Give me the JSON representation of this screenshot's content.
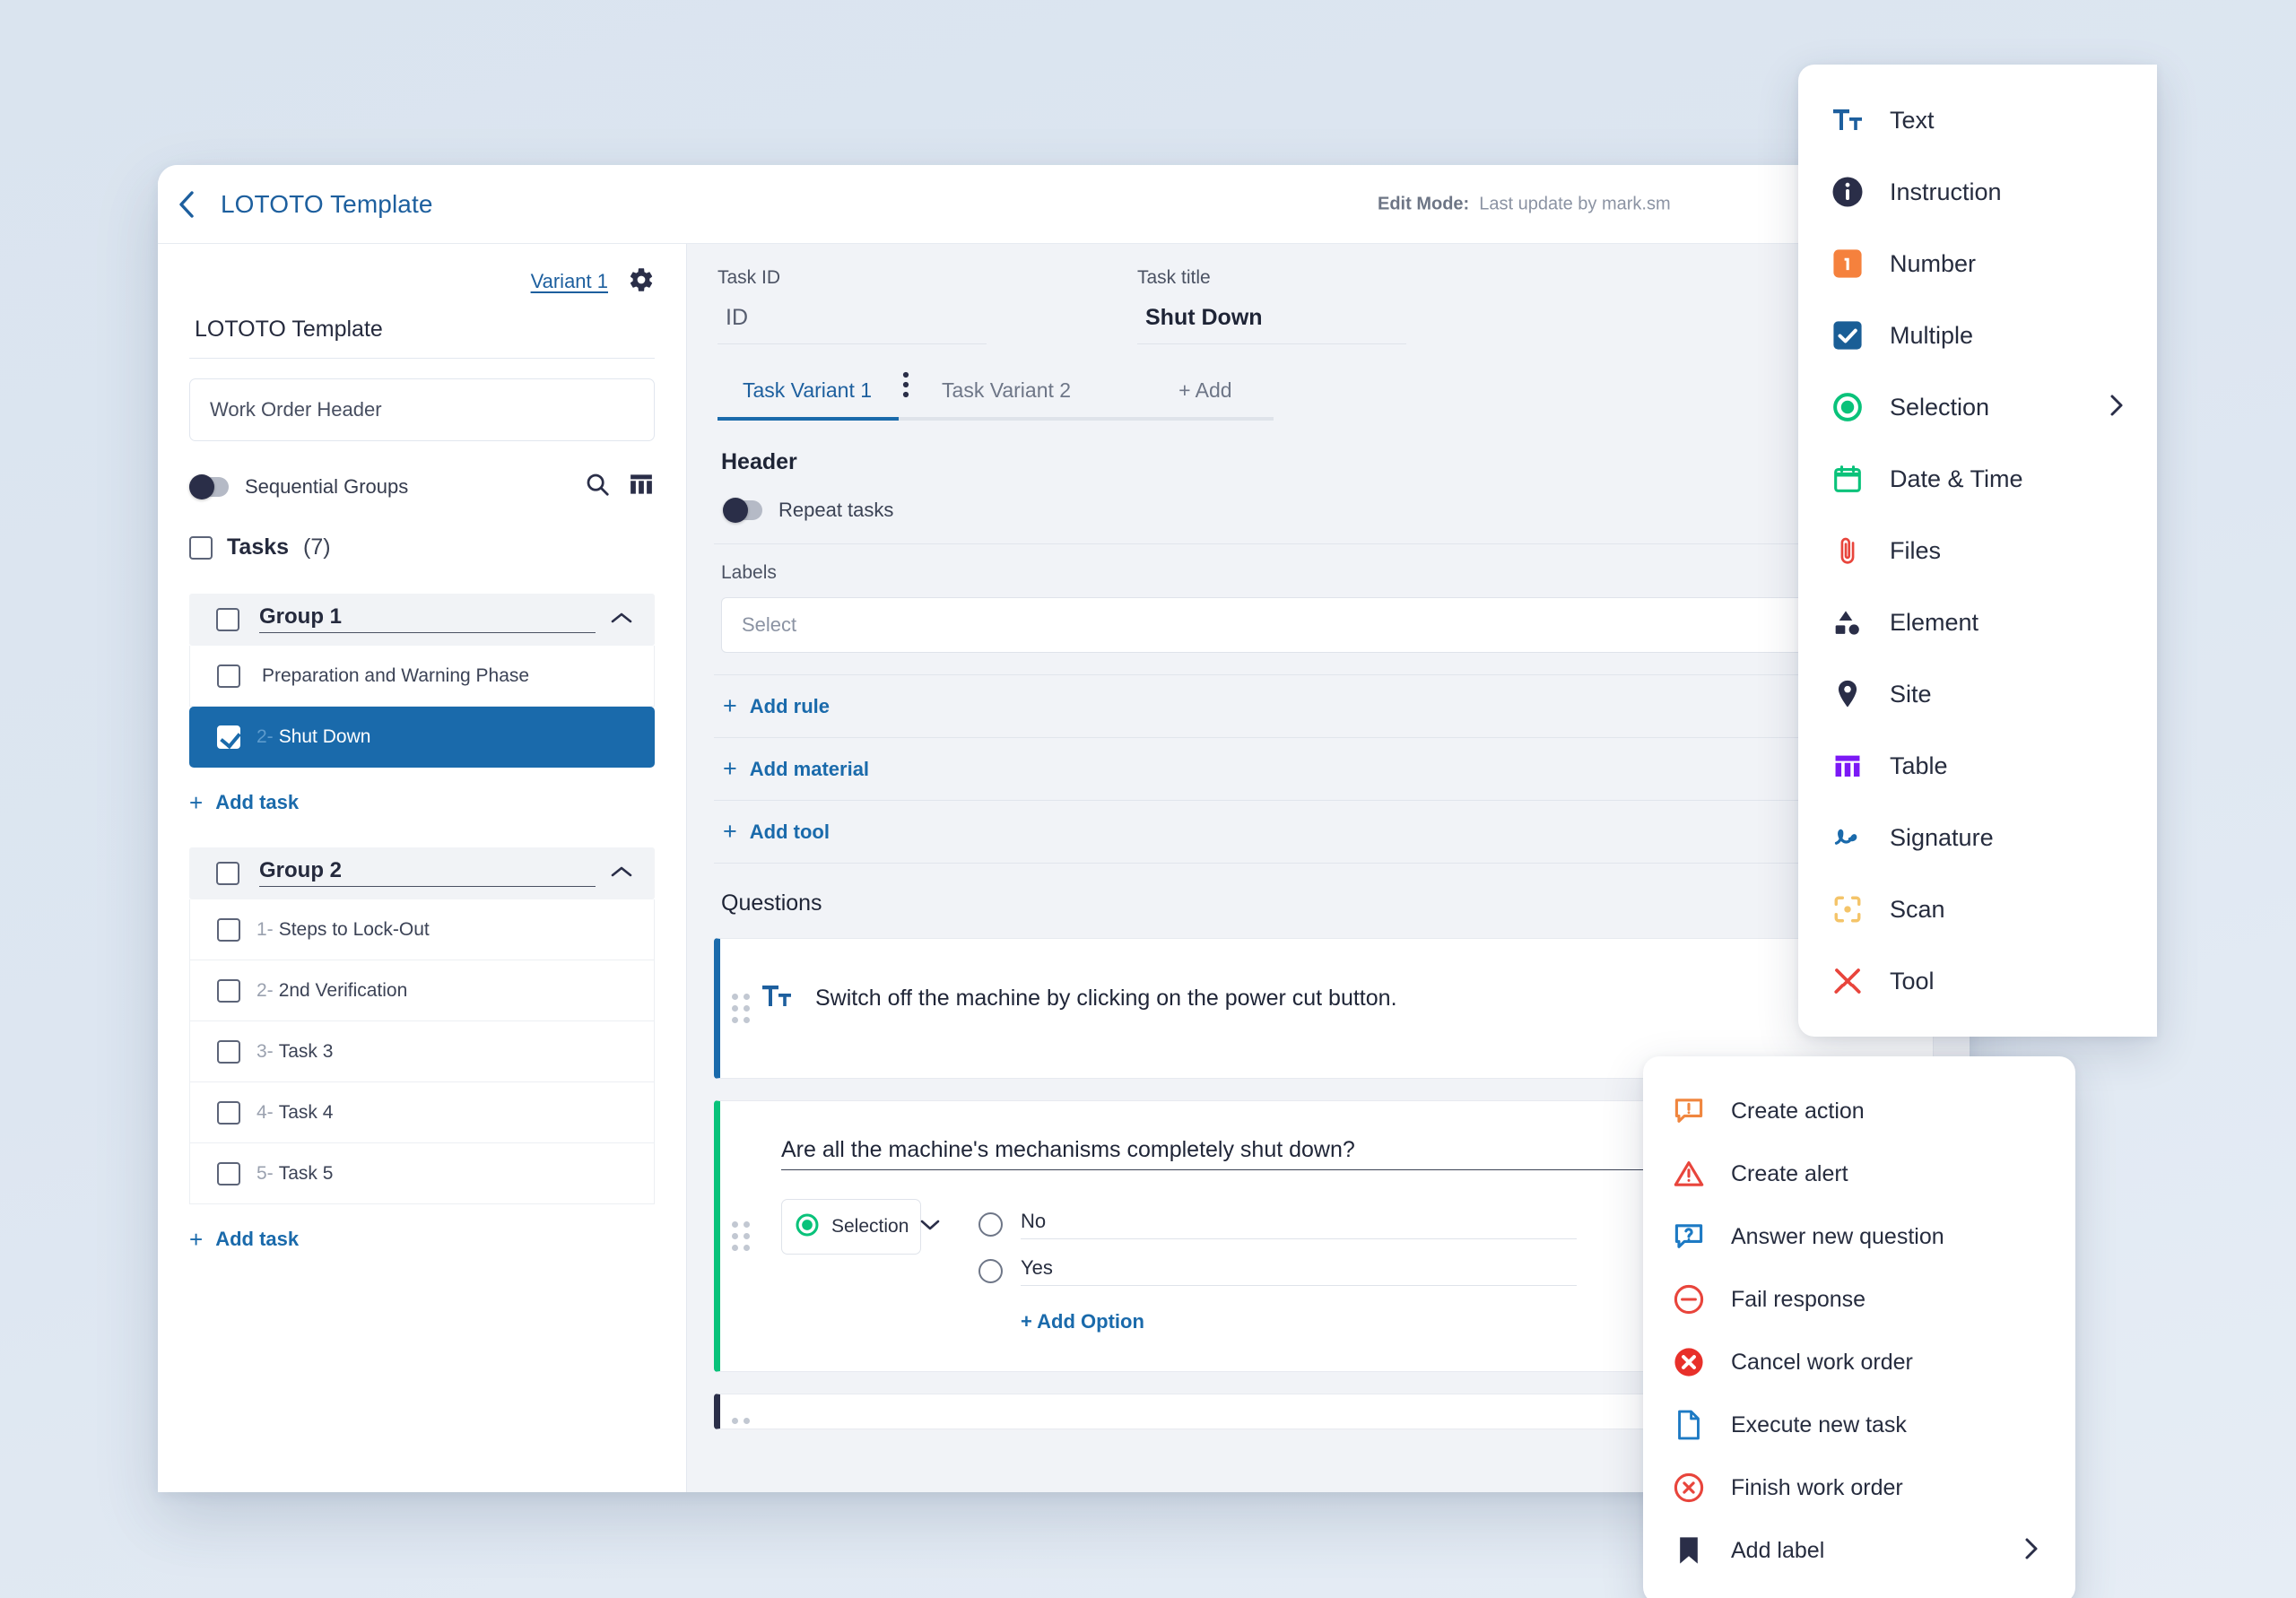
{
  "window": {
    "back_icon": "chevron-left-icon",
    "title": "LOTOTO Template",
    "edit_mode_label": "Edit Mode:",
    "edit_mode_value": "Last update by mark.sm"
  },
  "sidebar": {
    "variant_link": "Variant 1",
    "gear_icon": "gear-icon",
    "template_name": "LOTOTO Template",
    "work_order_header": "Work Order Header",
    "sequential_groups_label": "Sequential Groups",
    "sequential_groups_on": false,
    "search_icon": "search-icon",
    "table_icon": "table-icon",
    "tasks_title": "Tasks",
    "tasks_count": "(7)",
    "groups": [
      {
        "name": "Group 1",
        "collapse_icon": "chevron-up-icon",
        "add_task_label": "Add task",
        "tasks": [
          {
            "prefix": "",
            "label": "Preparation and Warning Phase",
            "checked": false,
            "selected": false
          },
          {
            "prefix": "2-",
            "label": "Shut Down",
            "checked": true,
            "selected": true
          }
        ]
      },
      {
        "name": "Group 2",
        "collapse_icon": "chevron-up-icon",
        "add_task_label": "Add task",
        "tasks": [
          {
            "prefix": "1-",
            "label": "Steps to Lock-Out",
            "checked": false,
            "selected": false
          },
          {
            "prefix": "2-",
            "label": "2nd Verification",
            "checked": false,
            "selected": false
          },
          {
            "prefix": "3-",
            "label": "Task 3",
            "checked": false,
            "selected": false
          },
          {
            "prefix": "4-",
            "label": "Task 4",
            "checked": false,
            "selected": false
          },
          {
            "prefix": "5-",
            "label": "Task 5",
            "checked": false,
            "selected": false
          }
        ]
      }
    ]
  },
  "main": {
    "task_id_label": "Task ID",
    "task_id_placeholder": "ID",
    "task_title_label": "Task title",
    "task_title_value": "Shut Down",
    "variant_tabs": [
      {
        "label": "Task Variant 1",
        "active": true
      },
      {
        "label": "Task Variant 2",
        "active": false
      },
      {
        "label": "+ Add",
        "active": false
      }
    ],
    "kebab_icon": "more-vertical-icon",
    "header_section": {
      "title": "Header",
      "repeat_tasks_label": "Repeat tasks",
      "repeat_tasks_on": false,
      "labels_label": "Labels",
      "labels_placeholder": "Select",
      "add_rule": "Add rule",
      "add_material": "Add material",
      "add_tool": "Add tool"
    },
    "questions_title": "Questions",
    "questions": [
      {
        "accent": "#1a6aab",
        "type_icon": "text-format-icon",
        "text": "Switch off the machine by clicking on the power cut button."
      },
      {
        "accent": "#09c27a",
        "title": "Are all the machine's mechanisms completely shut down?",
        "type_label": "Selection",
        "type_icon": "radio-selected-icon",
        "dropdown_icon": "chevron-down-icon",
        "options": [
          "No",
          "Yes"
        ],
        "add_option": "+ Add Option"
      },
      {
        "accent": "#2a2e48",
        "title": "",
        "type_label": "",
        "options": []
      }
    ]
  },
  "type_menu": {
    "items": [
      {
        "label": "Text",
        "icon": "text-format-icon",
        "color": "#1d5f9e",
        "submenu": false
      },
      {
        "label": "Instruction",
        "icon": "info-circle-icon",
        "color": "#2a2e48",
        "submenu": false
      },
      {
        "label": "Number",
        "icon": "number-one-icon",
        "color": "#f5813d",
        "submenu": false
      },
      {
        "label": "Multiple",
        "icon": "checkbox-icon",
        "color": "#1a5e96",
        "submenu": false
      },
      {
        "label": "Selection",
        "icon": "radio-selected-icon",
        "color": "#09c27a",
        "submenu": true
      },
      {
        "label": "Date & Time",
        "icon": "calendar-icon",
        "color": "#09c27a",
        "submenu": false
      },
      {
        "label": "Files",
        "icon": "paperclip-icon",
        "color": "#e8453c",
        "submenu": false
      },
      {
        "label": "Element",
        "icon": "shapes-icon",
        "color": "#2a2e48",
        "submenu": false
      },
      {
        "label": "Site",
        "icon": "map-pin-icon",
        "color": "#2a2e48",
        "submenu": false
      },
      {
        "label": "Table",
        "icon": "table-icon",
        "color": "#7b19f5",
        "submenu": false
      },
      {
        "label": "Signature",
        "icon": "signature-icon",
        "color": "#1a6aab",
        "submenu": false
      },
      {
        "label": "Scan",
        "icon": "scan-icon",
        "color": "#f4c469",
        "submenu": false
      },
      {
        "label": "Tool",
        "icon": "tools-icon",
        "color": "#e8453c",
        "submenu": false
      }
    ]
  },
  "action_menu": {
    "items": [
      {
        "label": "Create action",
        "icon": "comment-alert-icon",
        "color": "#f0863f",
        "submenu": false
      },
      {
        "label": "Create alert",
        "icon": "warning-triangle-icon",
        "color": "#e8453c",
        "submenu": false
      },
      {
        "label": "Answer new question",
        "icon": "comment-question-icon",
        "color": "#1d7ac4",
        "submenu": false
      },
      {
        "label": "Fail response",
        "icon": "minus-circle-icon",
        "color": "#e8453c",
        "submenu": false
      },
      {
        "label": "Cancel work order",
        "icon": "x-circle-filled-icon",
        "color": "#e8302a",
        "submenu": false
      },
      {
        "label": "Execute new task",
        "icon": "file-icon",
        "color": "#1d7ac4",
        "submenu": false
      },
      {
        "label": "Finish work order",
        "icon": "x-circle-icon",
        "color": "#e8453c",
        "submenu": false
      },
      {
        "label": "Add label",
        "icon": "bookmark-icon",
        "color": "#2a2e48",
        "submenu": true
      }
    ]
  }
}
